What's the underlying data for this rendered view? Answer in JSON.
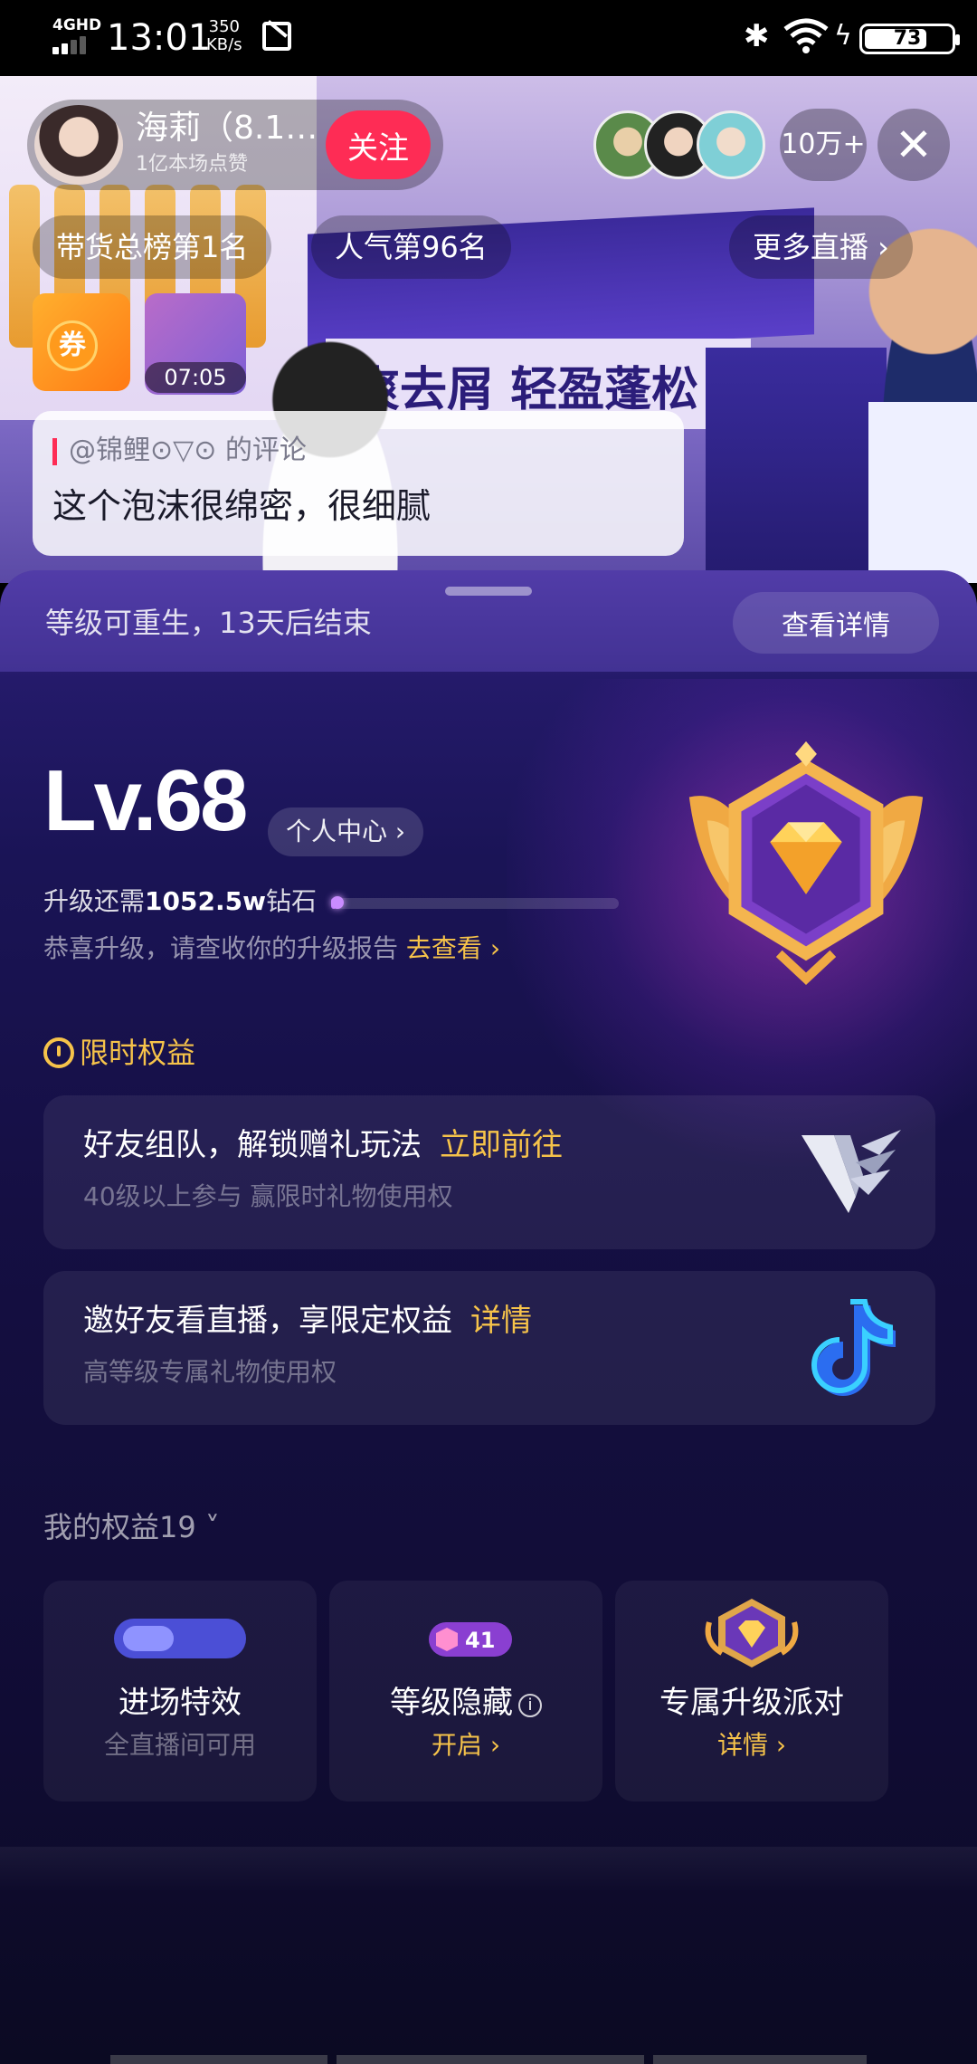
{
  "status_bar": {
    "network": "4GHD",
    "time": "13:01",
    "speed_value": "350",
    "speed_unit": "KB/s",
    "battery": "73"
  },
  "live": {
    "host_name": "海莉（8.1…",
    "host_likes": "1亿本场点赞",
    "follow_label": "关注",
    "viewer_count": "10万+",
    "close_icon": "✕",
    "chips": [
      "带货总榜第1名",
      "人气第96名",
      "更多直播 ›"
    ],
    "coupon_label": "券",
    "gift_timer": "07:05",
    "video_text": "爽去屑 轻盈蓬松",
    "comment_author": "@锦鲤⊙▽⊙ 的评论",
    "comment_text": "这个泡沫很绵密，很细腻"
  },
  "sheet": {
    "rebirth_text": "等级可重生，13天后结束",
    "details_button": "查看详情",
    "level": "Lv.68",
    "personal_center": "个人中心 ›",
    "upgrade_prefix": "升级还需",
    "upgrade_amount": "1052.5w",
    "upgrade_suffix": "钻石",
    "upgrade_progress": 0.02,
    "congrats_text": "恭喜升级，请查收你的升级报告",
    "congrats_link": "去查看 ›",
    "limited_title": "限时权益",
    "cards": [
      {
        "title": "好友组队，解锁赠礼玩法",
        "link": "立即前往",
        "sub": "40级以上参与 赢限时礼物使用权"
      },
      {
        "title": "邀好友看直播，享限定权益",
        "link": "详情",
        "sub": "高等级专属礼物使用权"
      }
    ],
    "my_rights_title": "我的权益19",
    "benefits": [
      {
        "title": "进场特效",
        "sub": "全直播间可用"
      },
      {
        "title": "等级隐藏",
        "link": "开启 ›",
        "badge_num": "41"
      },
      {
        "title": "专属升级派对",
        "link": "详情 ›"
      }
    ]
  },
  "colors": {
    "accent_gold": "#f6c34a",
    "follow_red": "#fe2c55",
    "progress_purple": "#b86cff"
  }
}
